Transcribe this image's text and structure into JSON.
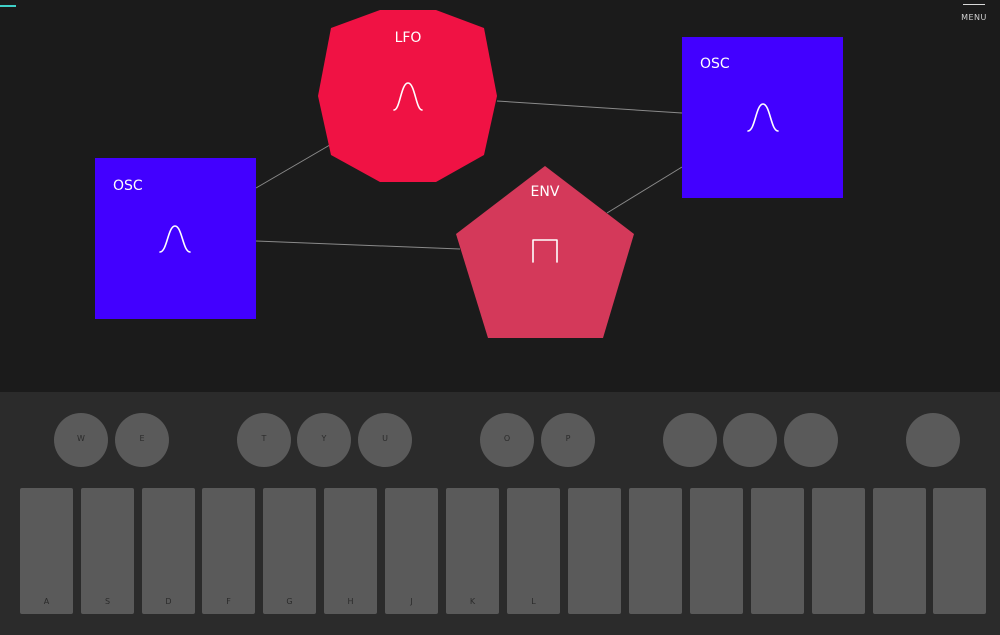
{
  "menu": {
    "label": "MENU"
  },
  "nodes": {
    "lfo": {
      "label": "LFO",
      "color": "#f01244",
      "shape": "decagon",
      "icon": "sine-wave-icon"
    },
    "osc_left": {
      "label": "OSC",
      "color": "#4200ff",
      "shape": "square",
      "icon": "sine-wave-icon"
    },
    "osc_right": {
      "label": "OSC",
      "color": "#4200ff",
      "shape": "square",
      "icon": "sine-wave-icon"
    },
    "env": {
      "label": "ENV",
      "color": "#d4395a",
      "shape": "pentagon",
      "icon": "square-pulse-icon"
    }
  },
  "keyboard": {
    "black_keys": [
      "W",
      "E",
      "T",
      "Y",
      "U",
      "O",
      "P",
      "",
      "",
      "",
      ""
    ],
    "white_keys": [
      "A",
      "S",
      "D",
      "F",
      "G",
      "H",
      "J",
      "K",
      "L",
      "",
      "",
      "",
      "",
      "",
      "",
      "",
      ""
    ]
  },
  "colors": {
    "background": "#1b1b1b",
    "keyboard_panel": "#2b2b2b",
    "key": "#5a5a5a",
    "accent": "#3fd0c8"
  }
}
